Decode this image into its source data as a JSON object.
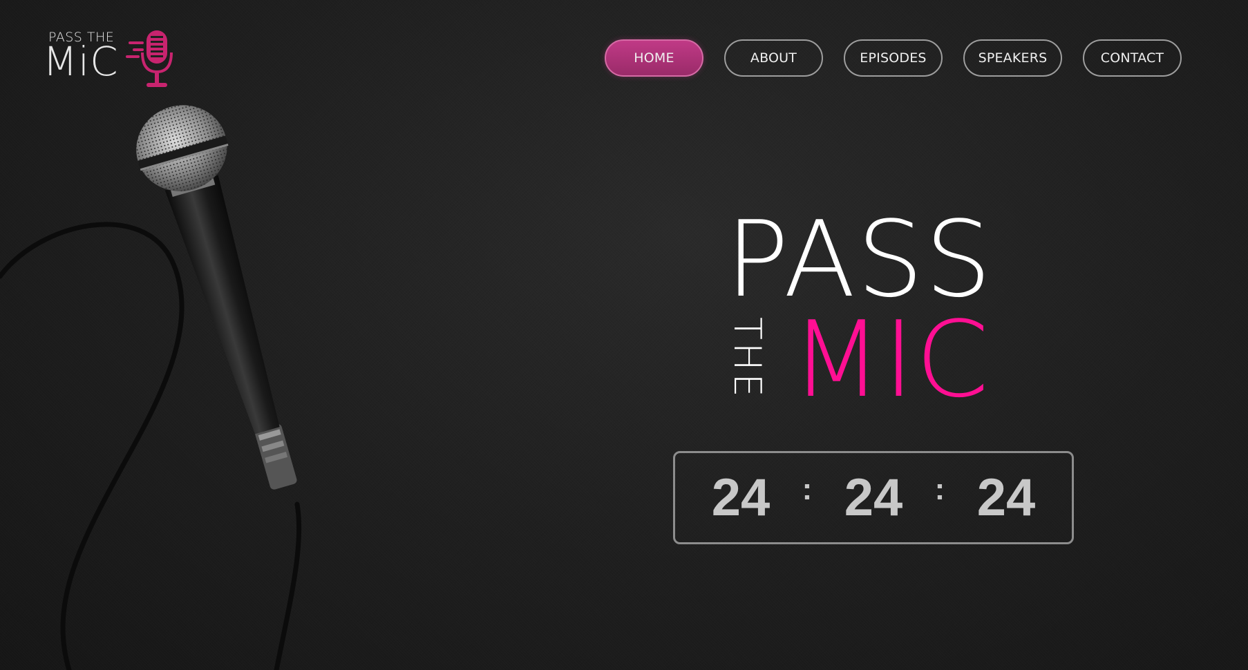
{
  "logo": {
    "top_text": "PASS THE",
    "bottom_text": "MiC",
    "mic_icon": "microphone-icon",
    "accent": "#c8246f"
  },
  "nav": {
    "items": [
      {
        "label": "HOME",
        "active": true
      },
      {
        "label": "ABOUT",
        "active": false
      },
      {
        "label": "EPISODES",
        "active": false
      },
      {
        "label": "SPEAKERS",
        "active": false
      },
      {
        "label": "CONTACT",
        "active": false
      }
    ]
  },
  "hero": {
    "line1": "PASS",
    "vertical": "THE",
    "line2": "MIC",
    "accent": "#ff0f93"
  },
  "countdown": {
    "hours": "24",
    "minutes": "24",
    "seconds": "24",
    "separator": ":"
  },
  "background_image": "microphone-with-cable"
}
